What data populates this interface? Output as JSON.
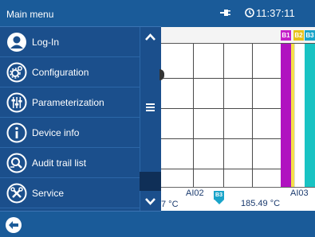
{
  "menu": {
    "title": "Main menu",
    "items": [
      {
        "label": "Log-In",
        "icon": "user-icon"
      },
      {
        "label": "Configuration",
        "icon": "gears-icon"
      },
      {
        "label": "Parameterization",
        "icon": "sliders-icon"
      },
      {
        "label": "Device info",
        "icon": "info-icon"
      },
      {
        "label": "Audit trail list",
        "icon": "audit-trail-icon"
      },
      {
        "label": "Service",
        "icon": "tools-icon"
      }
    ],
    "back_icon": "back-arrow-icon"
  },
  "status": {
    "time": "11:37:11",
    "icons": [
      "plug-icon",
      "clock-icon"
    ]
  },
  "chart": {
    "channel_tags": [
      {
        "label": "B1",
        "color": "#c41fc8"
      },
      {
        "label": "B2",
        "color": "#e8c21a"
      },
      {
        "label": "B3",
        "color": "#1aa4c9"
      }
    ],
    "trend_colors": {
      "b1": "#b012c0",
      "b2": "#f5e04a",
      "b3": "#19c3c3"
    }
  },
  "values": {
    "left_reading": "7 °C",
    "ai02": "AI02",
    "b3_tag": "B3",
    "reading": "185.49 °C",
    "ai03": "AI03"
  },
  "colors": {
    "bar": "#1a5b99",
    "menu_bg": "#1b4f8c",
    "text_value": "#1a3a6e"
  }
}
